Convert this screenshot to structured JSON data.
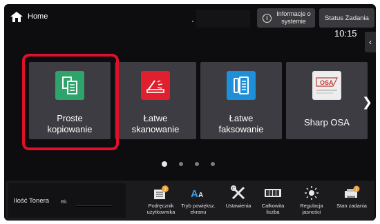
{
  "header": {
    "home_label": "Home",
    "info_label_line1": "Informacje o",
    "info_label_line2": "systemie",
    "status_label": "Status Zadania",
    "time": "10:15"
  },
  "apps": [
    {
      "line1": "Proste",
      "line2": "kopiowanie",
      "icon": "copy-icon",
      "color": "#2ea36a"
    },
    {
      "line1": "Łatwe",
      "line2": "skanowanie",
      "icon": "scan-icon",
      "color": "#e0202e"
    },
    {
      "line1": "Łatwe",
      "line2": "faksowanie",
      "icon": "fax-icon",
      "color": "#1e8fd8"
    },
    {
      "line1": "Sharp OSA",
      "line2": "",
      "icon": "sharp-osa-icon",
      "color": "#d8d8d8"
    }
  ],
  "pager": {
    "total": 4,
    "active": 1
  },
  "toner": {
    "label": "Ilość Tonera",
    "color_code": "Bk"
  },
  "shortcuts": [
    {
      "line1": "Podręcznik",
      "line2": "użytkownika",
      "icon": "manual-icon"
    },
    {
      "line1": "Tryb powiększ.",
      "line2": "ekranu",
      "icon": "text-zoom-icon"
    },
    {
      "line1": "Ustawienia",
      "line2": "",
      "icon": "settings-tools-icon"
    },
    {
      "line1": "Całkowita",
      "line2": "liczba",
      "icon": "counter-icon"
    },
    {
      "line1": "Regulacja",
      "line2": "jasności",
      "icon": "brightness-icon"
    },
    {
      "line1": "Stan zadania",
      "line2": "",
      "icon": "job-status-icon"
    }
  ],
  "colors": {
    "highlight": "#e0102a",
    "tile_bg": "#3c3c42",
    "screen_bg": "#0d0d0f"
  }
}
